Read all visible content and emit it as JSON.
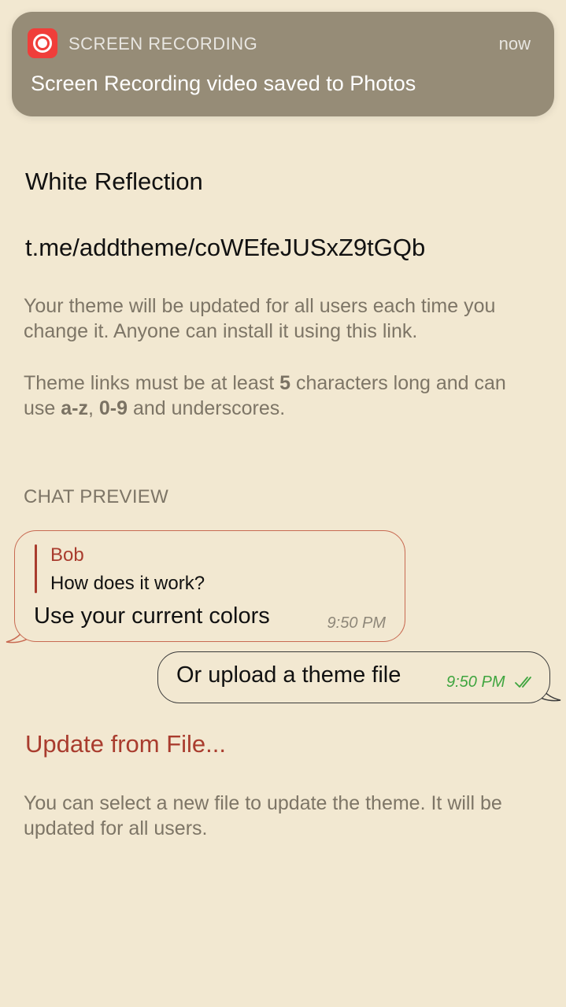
{
  "notification": {
    "app_name": "SCREEN RECORDING",
    "time": "now",
    "message": "Screen Recording video saved to Photos",
    "icon": "screen-recording-icon",
    "icon_color": "#f03e3a"
  },
  "theme": {
    "name": "White Reflection",
    "link": "t.me/addtheme/coWEfeJUSxZ9tGQb"
  },
  "info": {
    "update_note": "Your theme will be updated for all users each time you change it. Anyone can install it using this link.",
    "rules": {
      "part1": "Theme links must be at least ",
      "min_length": "5",
      "part2": " characters long and can use ",
      "letters": "a-z",
      "sep": ", ",
      "digits": "0-9",
      "part3": " and underscores."
    }
  },
  "chat_preview": {
    "header": "CHAT PREVIEW",
    "incoming": {
      "reply_name": "Bob",
      "reply_text": "How does it work?",
      "text": "Use your current colors",
      "time": "9:50 PM"
    },
    "outgoing": {
      "text": "Or upload a theme file",
      "time": "9:50 PM",
      "status_icon": "double-check-icon"
    }
  },
  "update_from_file": {
    "label": "Update from File...",
    "note": "You can select a new file to update the theme. It will be updated for all users."
  },
  "colors": {
    "background": "#f2e8d1",
    "accent": "#a93c2e",
    "time_outgoing": "#3fa53f",
    "secondary_text": "#7d7566"
  }
}
